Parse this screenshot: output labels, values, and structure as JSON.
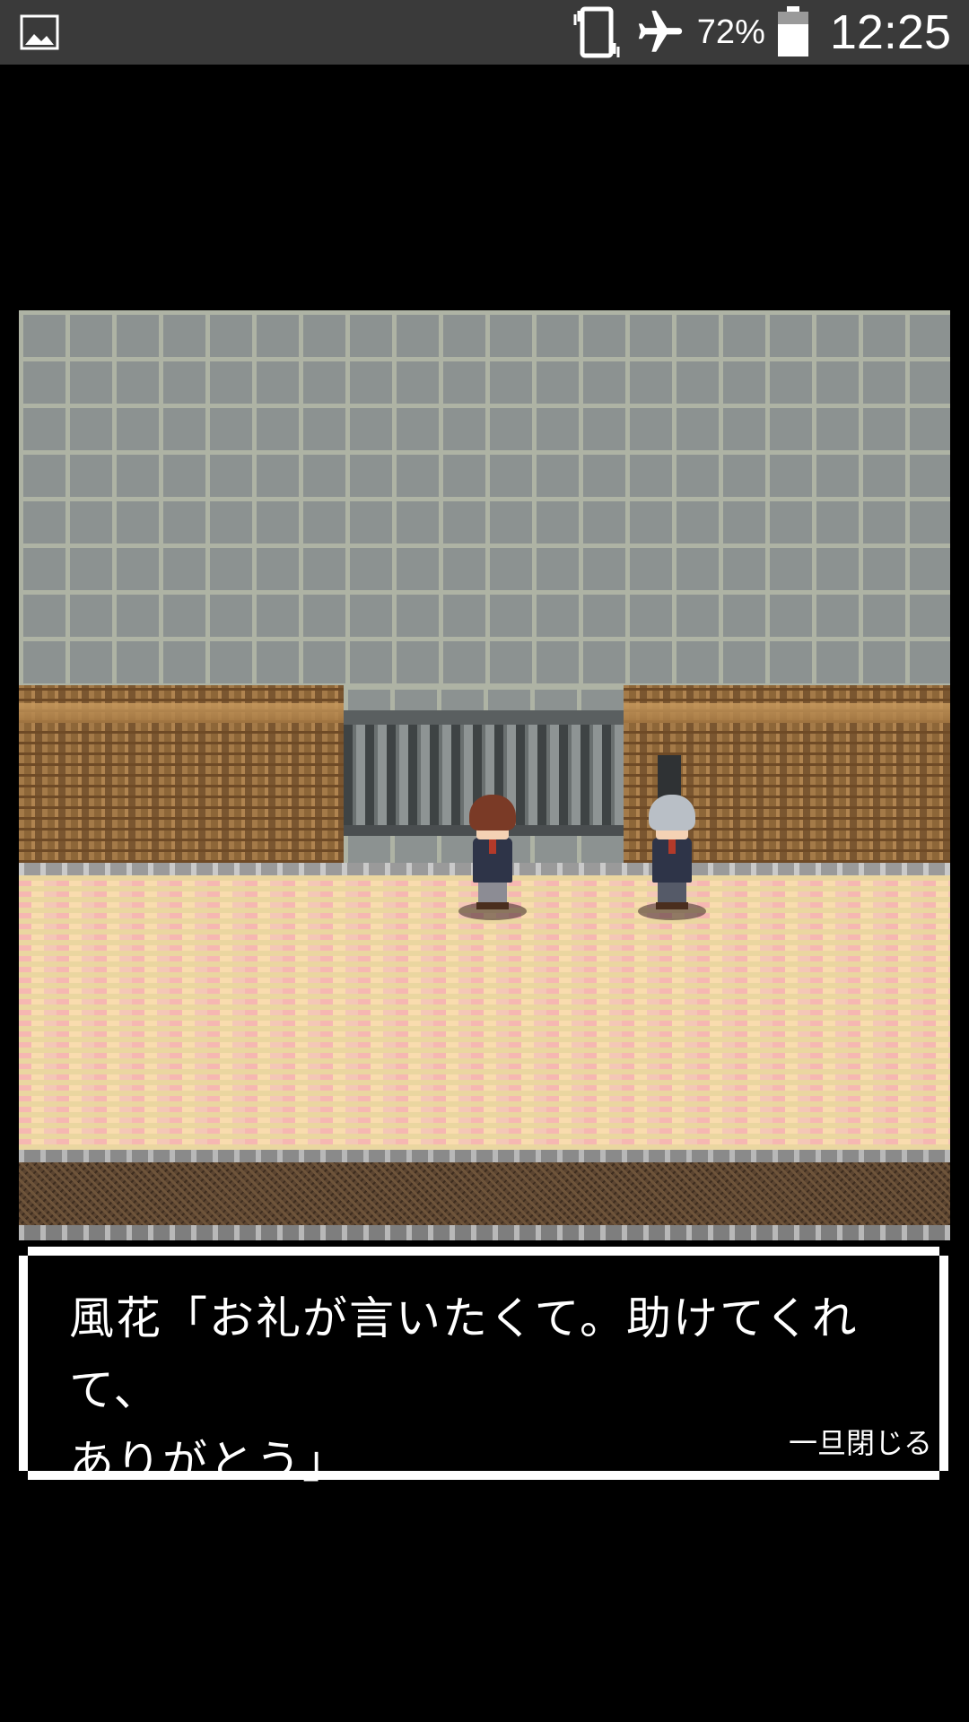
{
  "status_bar": {
    "battery_percent": "72%",
    "time": "12:25",
    "icons": [
      "image-notification-icon",
      "vibrate-icon",
      "airplane-mode-icon",
      "battery-icon"
    ]
  },
  "dialogue": {
    "text": "風花「お礼が言いたくて。助けてくれて、\nありがとう」",
    "close_label": "一旦閉じる"
  }
}
